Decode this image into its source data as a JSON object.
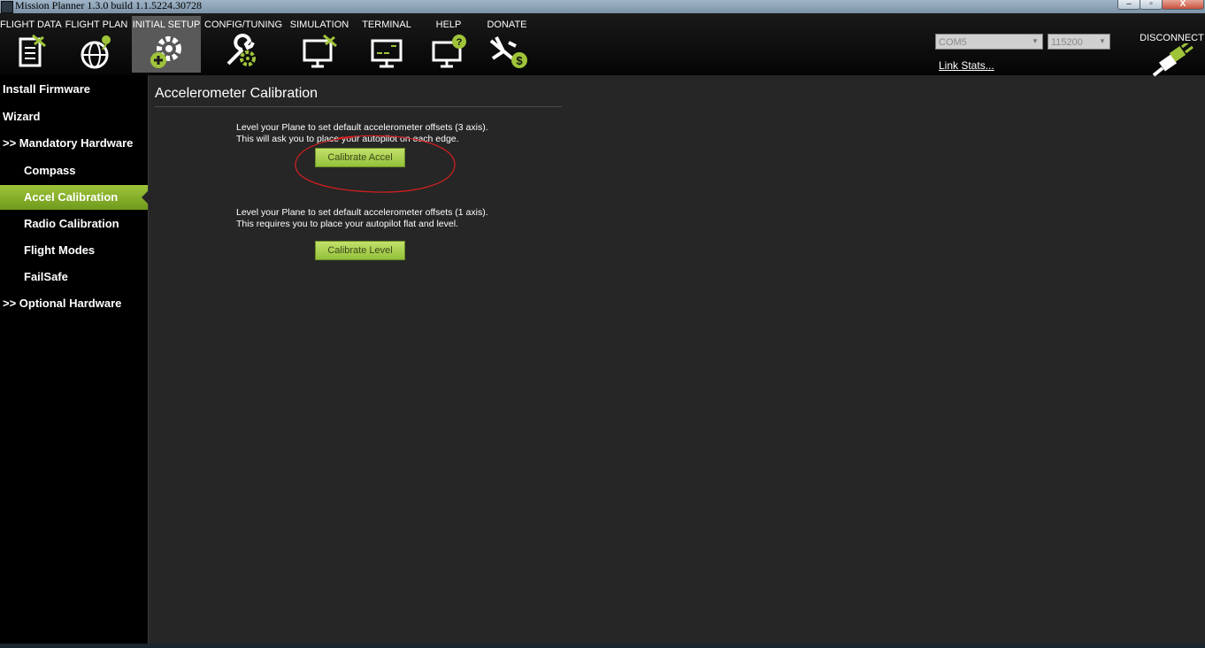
{
  "window": {
    "title": "Mission Planner 1.3.0 build 1.1.5224.30728",
    "minimize": "–",
    "maximize": "▫",
    "close": "X"
  },
  "toolbar": {
    "items": [
      {
        "label": "FLIGHT DATA",
        "icon": "flight-data-icon"
      },
      {
        "label": "FLIGHT PLAN",
        "icon": "flight-plan-icon"
      },
      {
        "label": "INITIAL SETUP",
        "icon": "initial-setup-icon",
        "active": true
      },
      {
        "label": "CONFIG/TUNING",
        "icon": "config-tuning-icon"
      },
      {
        "label": "SIMULATION",
        "icon": "simulation-icon"
      },
      {
        "label": "TERMINAL",
        "icon": "terminal-icon"
      },
      {
        "label": "HELP",
        "icon": "help-icon"
      },
      {
        "label": "DONATE",
        "icon": "donate-icon"
      }
    ],
    "com_port": "COM5",
    "baud_rate": "115200",
    "link_stats": "Link Stats...",
    "disconnect": "DISCONNECT"
  },
  "sidebar": {
    "items": [
      {
        "label": "Install Firmware"
      },
      {
        "label": "Wizard"
      },
      {
        "label": ">> Mandatory Hardware"
      },
      {
        "label": "Compass"
      },
      {
        "label": "Accel Calibration",
        "active": true
      },
      {
        "label": "Radio Calibration"
      },
      {
        "label": "Flight Modes"
      },
      {
        "label": "FailSafe"
      },
      {
        "label": ">> Optional Hardware"
      }
    ]
  },
  "main": {
    "title": "Accelerometer Calibration",
    "accel": {
      "line1": "Level your Plane to set default accelerometer offsets (3 axis).",
      "line2": "This will ask you to place your autopilot on each edge.",
      "button": "Calibrate Accel"
    },
    "level": {
      "line1": "Level your Plane to set default accelerometer offsets (1 axis).",
      "line2": "This requires you to place your autopilot flat and level.",
      "button": "Calibrate Level"
    }
  },
  "colors": {
    "accent_green": "#9fc43a",
    "annotation_red": "#d42020",
    "background": "#262626"
  }
}
